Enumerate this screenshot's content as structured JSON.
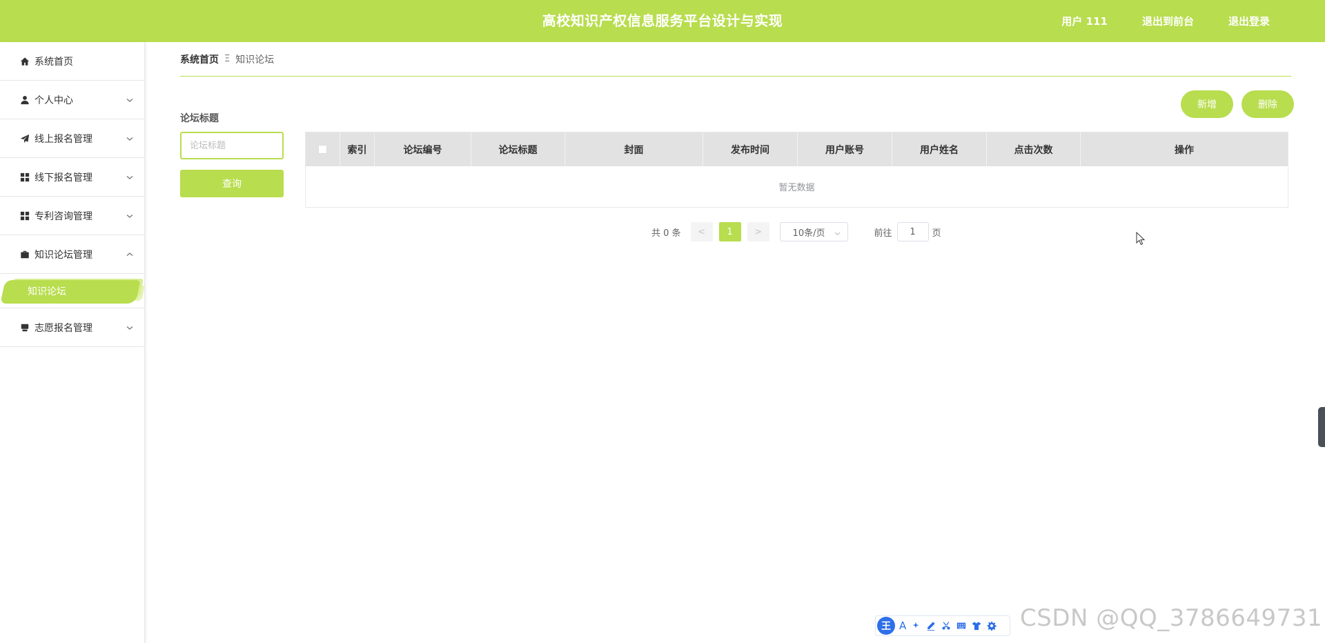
{
  "header": {
    "title": "高校知识产权信息服务平台设计与实现",
    "user_label": "用户 111",
    "to_front_label": "退出到前台",
    "logout_label": "退出登录"
  },
  "sidebar": {
    "items": [
      {
        "label": "系统首页",
        "icon": "home-icon"
      },
      {
        "label": "个人中心",
        "icon": "user-icon"
      },
      {
        "label": "线上报名管理",
        "icon": "paper-plane-icon"
      },
      {
        "label": "线下报名管理",
        "icon": "grid-icon"
      },
      {
        "label": "专利咨询管理",
        "icon": "grid-icon"
      },
      {
        "label": "知识论坛管理",
        "icon": "briefcase-icon"
      },
      {
        "label": "志愿报名管理",
        "icon": "printer-icon"
      }
    ],
    "active_sub": "知识论坛"
  },
  "breadcrumb": {
    "home": "系统首页",
    "separator": "Ξ",
    "current": "知识论坛"
  },
  "filter": {
    "label": "论坛标题",
    "placeholder": "论坛标题",
    "search_label": "查询"
  },
  "actions": {
    "add_label": "新增",
    "delete_label": "删除"
  },
  "table": {
    "columns": [
      "索引",
      "论坛编号",
      "论坛标题",
      "封面",
      "发布时间",
      "用户账号",
      "用户姓名",
      "点击次数",
      "操作"
    ],
    "empty_text": "暂无数据"
  },
  "pagination": {
    "total_text": "共 0 条",
    "prev": "<",
    "current_page": "1",
    "next": ">",
    "page_size": "10条/页",
    "goto_label": "前往",
    "goto_value": "1",
    "page_suffix": "页"
  },
  "ime": {
    "logo": "王",
    "letter": "A"
  },
  "watermark": "CSDN @QQ_3786649731",
  "colors": {
    "accent": "#b8dd4e"
  }
}
